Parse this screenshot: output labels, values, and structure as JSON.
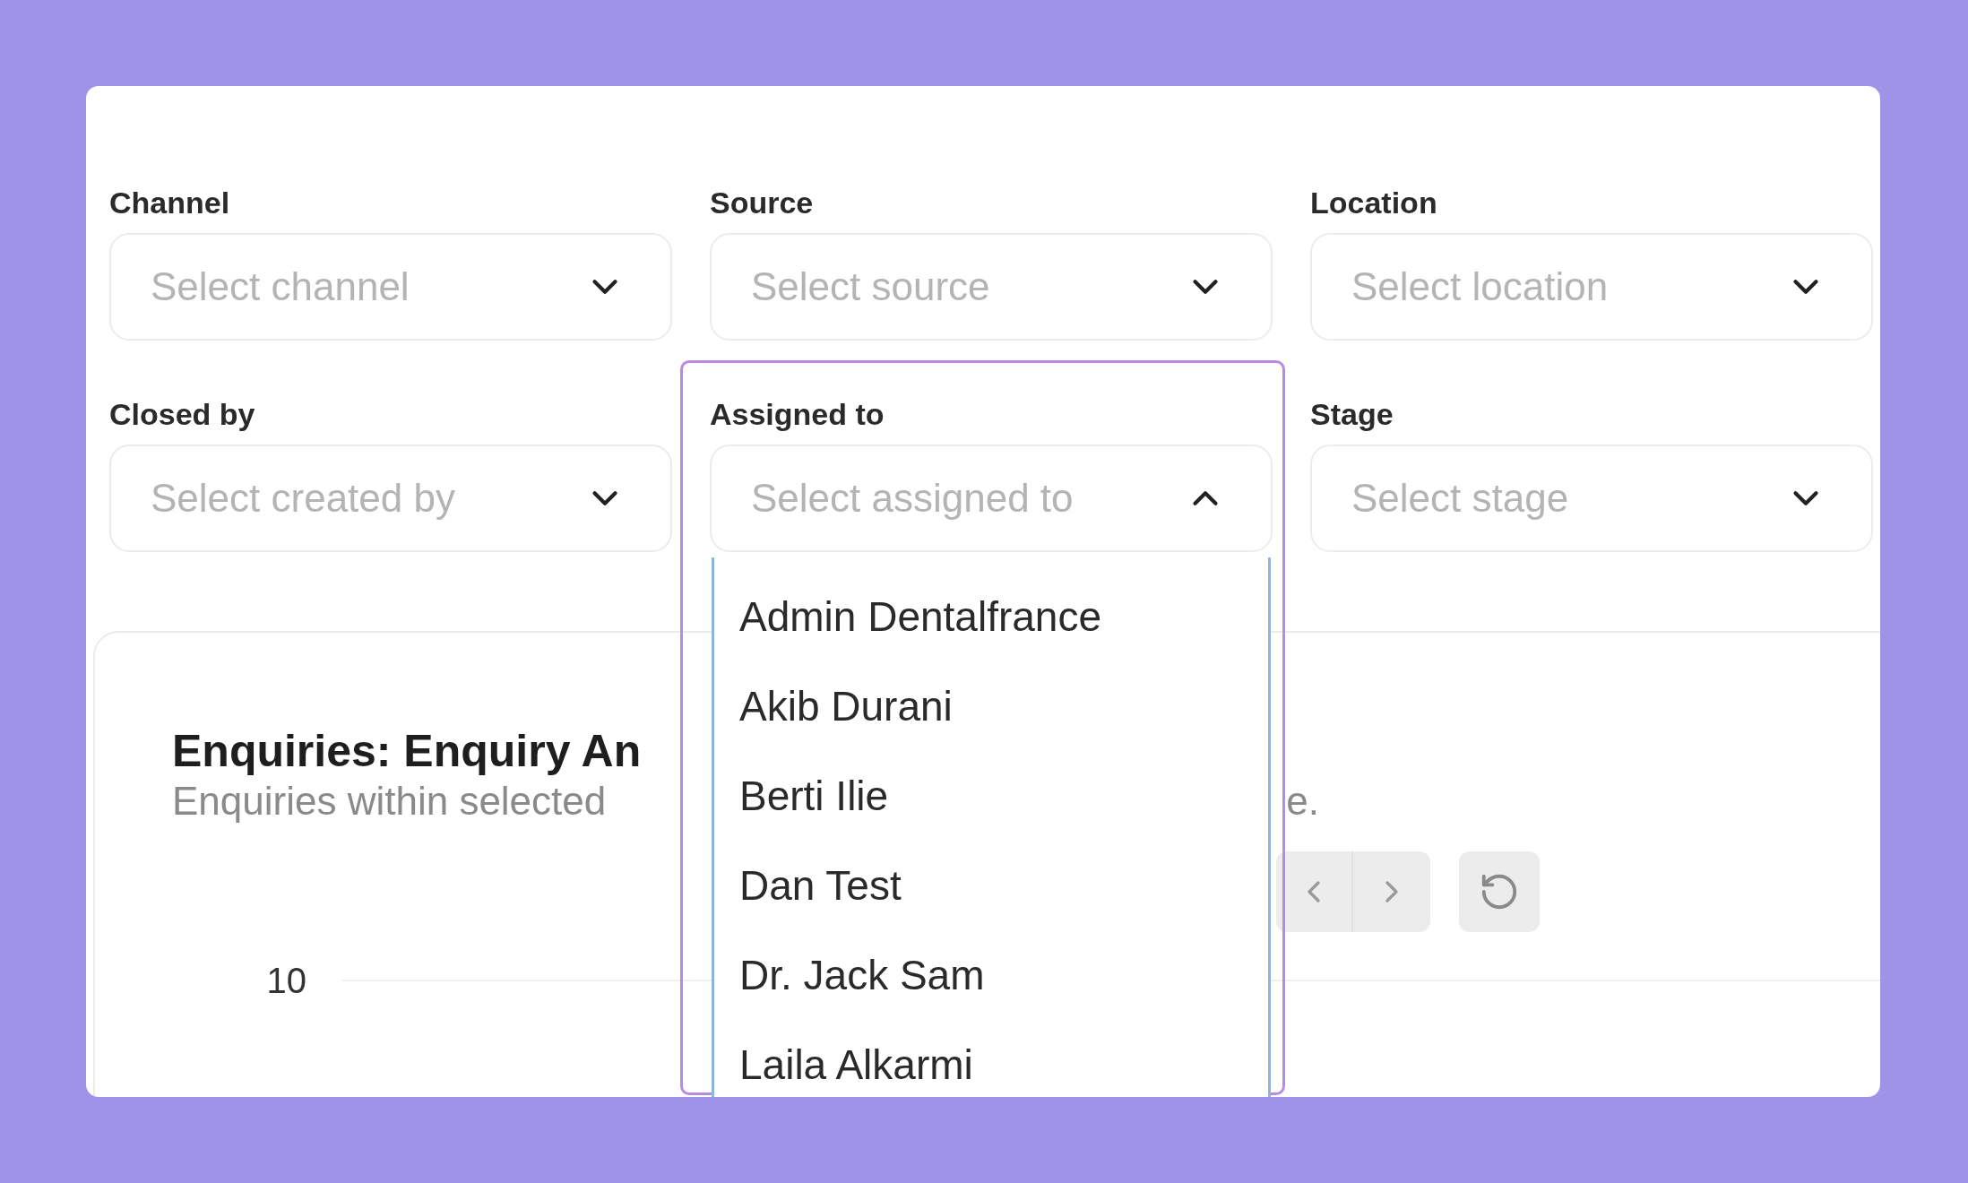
{
  "filters": [
    {
      "label": "Channel",
      "placeholder": "Select channel",
      "expanded": false
    },
    {
      "label": "Source",
      "placeholder": "Select source",
      "expanded": false
    },
    {
      "label": "Location",
      "placeholder": "Select location",
      "expanded": false
    },
    {
      "label": "Closed by",
      "placeholder": "Select created by",
      "expanded": false
    },
    {
      "label": "Assigned to",
      "placeholder": "Select assigned to",
      "expanded": true,
      "options": [
        "Admin Dentalfrance",
        "Akib Durani",
        "Berti Ilie",
        "Dan Test",
        "Dr. Jack Sam",
        "Laila Alkarmi"
      ]
    },
    {
      "label": "Stage",
      "placeholder": "Select stage",
      "expanded": false
    }
  ],
  "chart_card": {
    "title": "Enquiries: Enquiry An",
    "subtitle": "Enquiries within selected",
    "subtitle_end": "e.",
    "y_labels": [
      "10"
    ]
  }
}
